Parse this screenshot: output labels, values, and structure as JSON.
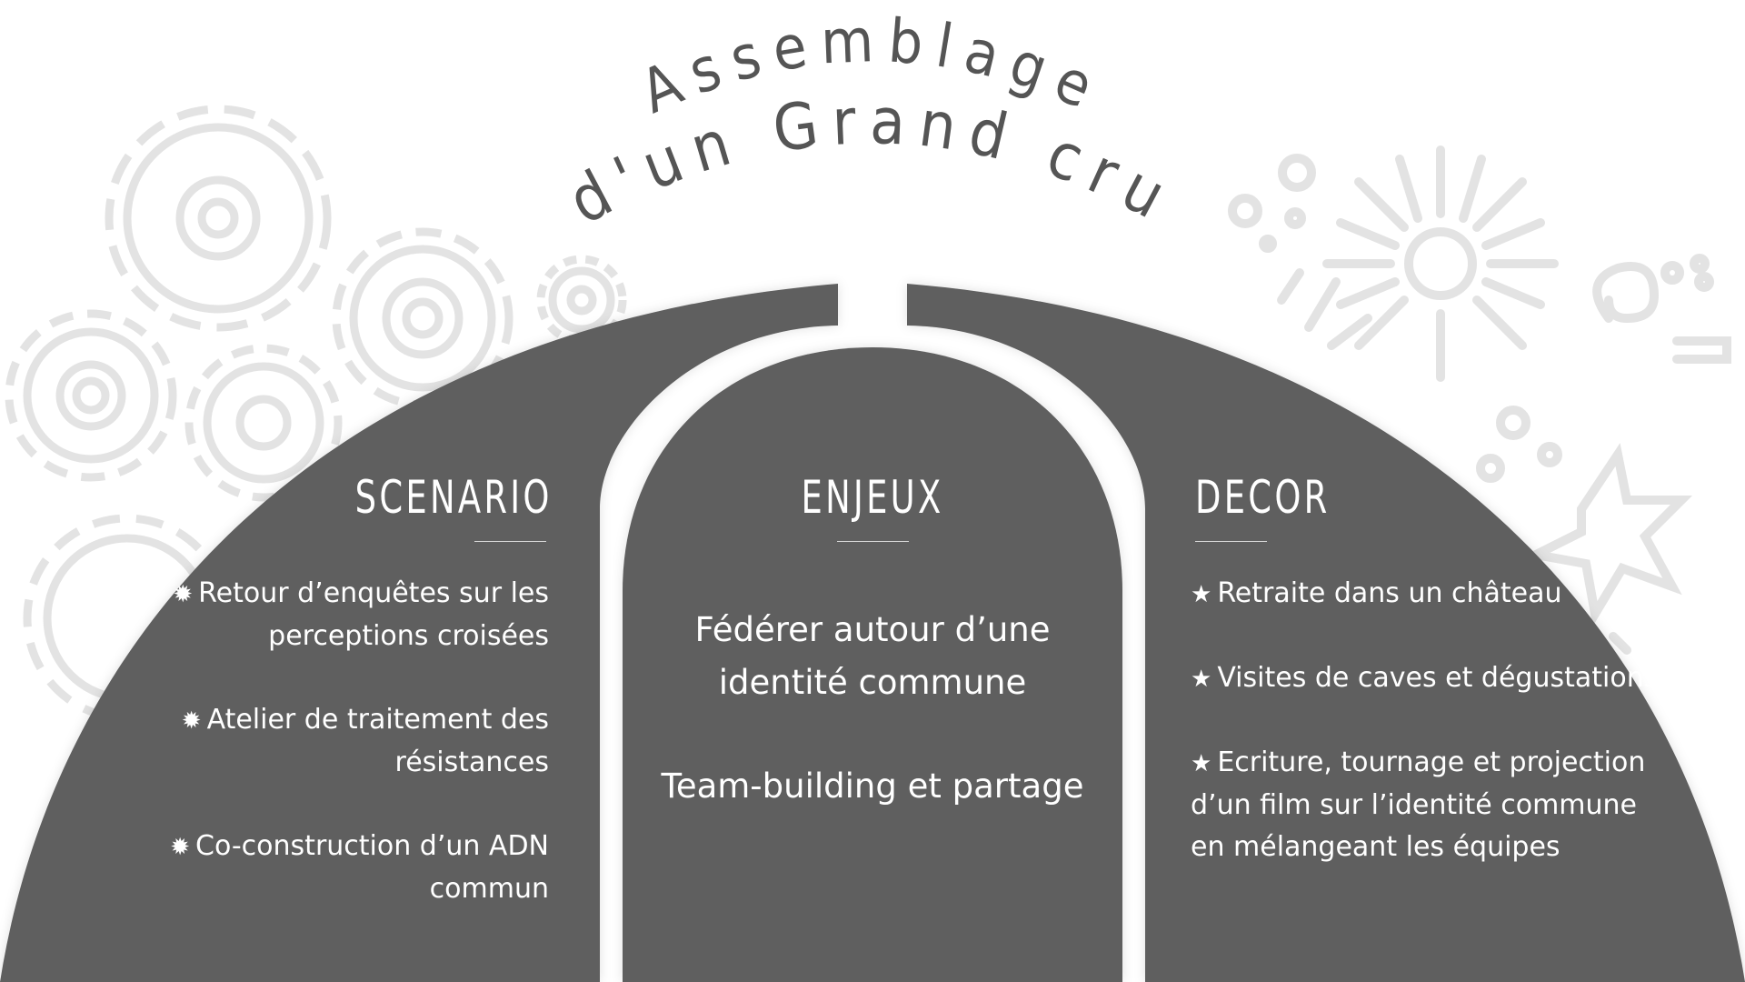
{
  "title": {
    "line1": "Assemblage",
    "line2": "d'un Grand cru"
  },
  "columns": {
    "left": {
      "heading": "SCENARIO",
      "icon": "gear-icon",
      "items": [
        "Retour d’enquêtes sur les perceptions croisées",
        "Atelier de traitement des résistances",
        "Co-construction d’un ADN commun"
      ]
    },
    "center": {
      "heading": "ENJEUX",
      "items": [
        "Fédérer autour d’une identité commune",
        "Team-building et partage"
      ]
    },
    "right": {
      "heading": "DECOR",
      "icon": "star-icon",
      "items": [
        "Retraite dans un château",
        "Visites de caves et dégustations",
        "Ecriture, tournage et projection d’un film sur l’identité commune en mélangeant les équipes"
      ]
    }
  },
  "colors": {
    "panel": "#5e5e5e",
    "decor": "#e3e3e3",
    "title": "#555555",
    "background": "#ffffff"
  }
}
